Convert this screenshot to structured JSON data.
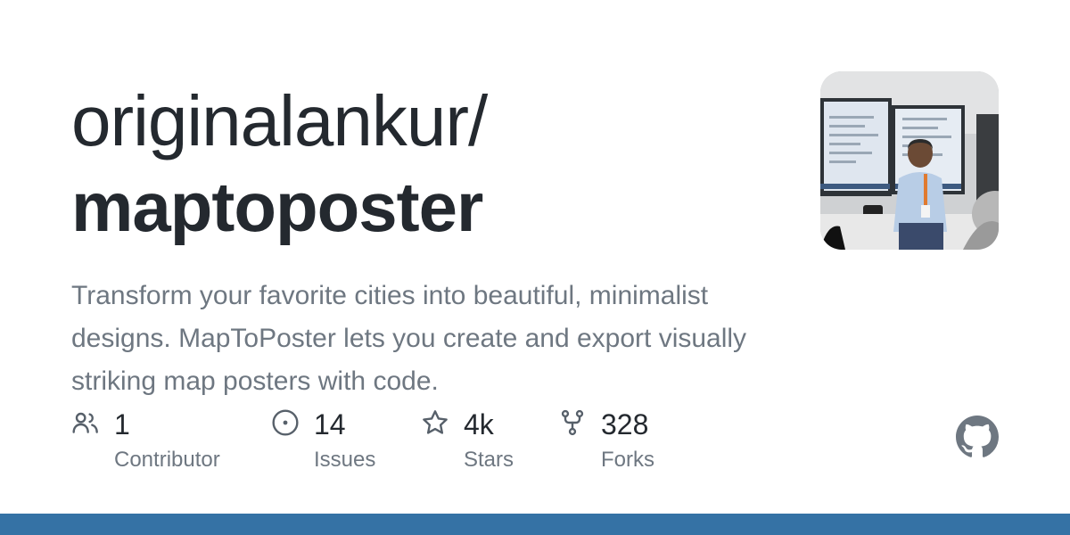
{
  "repo": {
    "owner": "originalankur/",
    "name": "maptoposter",
    "description": "Transform your favorite cities into beautiful, minimalist designs. MapToPoster lets you create and export visually striking map posters with code."
  },
  "stats": {
    "contributors": {
      "count": "1",
      "label": "Contributor",
      "icon": "people-icon"
    },
    "issues": {
      "count": "14",
      "label": "Issues",
      "icon": "issue-opened-icon"
    },
    "stars": {
      "count": "4k",
      "label": "Stars",
      "icon": "star-icon"
    },
    "forks": {
      "count": "328",
      "label": "Forks",
      "icon": "repo-forked-icon"
    }
  },
  "colors": {
    "title": "#24292f",
    "muted": "#6e7781",
    "icon": "#57606a",
    "logo": "#6e7781",
    "bottom_bar": "#3572a5"
  }
}
